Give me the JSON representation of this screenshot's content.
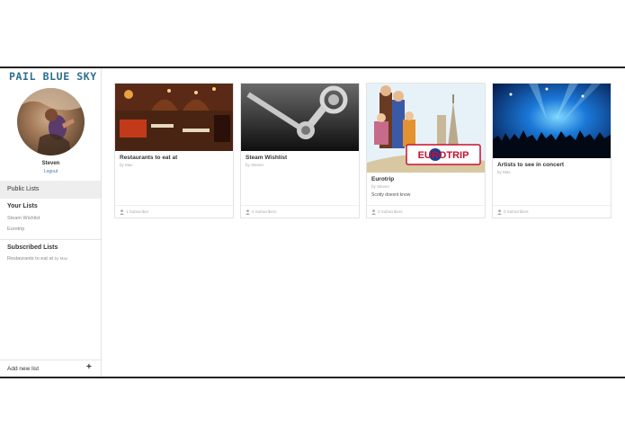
{
  "app": {
    "logo": "PAIL BLUE SKY"
  },
  "user": {
    "name": "Steven",
    "logout_label": "Logout"
  },
  "sidebar": {
    "public_lists_label": "Public Lists",
    "your_lists_heading": "Your Lists",
    "your_lists": [
      "Steam Wishlist",
      "Eurotrip"
    ],
    "subscribed_heading": "Subscribed Lists",
    "subscribed": [
      {
        "title": "Restaurants to eat at",
        "by": "by Max"
      }
    ],
    "add_new_label": "Add new list",
    "add_icon": "+"
  },
  "cards": [
    {
      "title": "Restaurants to eat at",
      "author": "by Max",
      "description": "",
      "subscribers": "1 Subscriber",
      "image": "restaurant-photo"
    },
    {
      "title": "Steam Wishlist",
      "author": "by Steven",
      "description": "",
      "subscribers": "0 Subscribers",
      "image": "steam-logo"
    },
    {
      "title": "Eurotrip",
      "author": "by Steven",
      "description": "Scotty doesnt know",
      "subscribers": "0 Subscribers",
      "image": "eurotrip-poster",
      "poster_text": "EUROTRIP"
    },
    {
      "title": "Artists to see in concert",
      "author": "by Max",
      "description": "",
      "subscribers": "0 Subscribers",
      "image": "concert-photo"
    }
  ],
  "colors": {
    "logo": "#2b6f8f",
    "link": "#4a78b0",
    "active_bg": "#eeeeee"
  }
}
